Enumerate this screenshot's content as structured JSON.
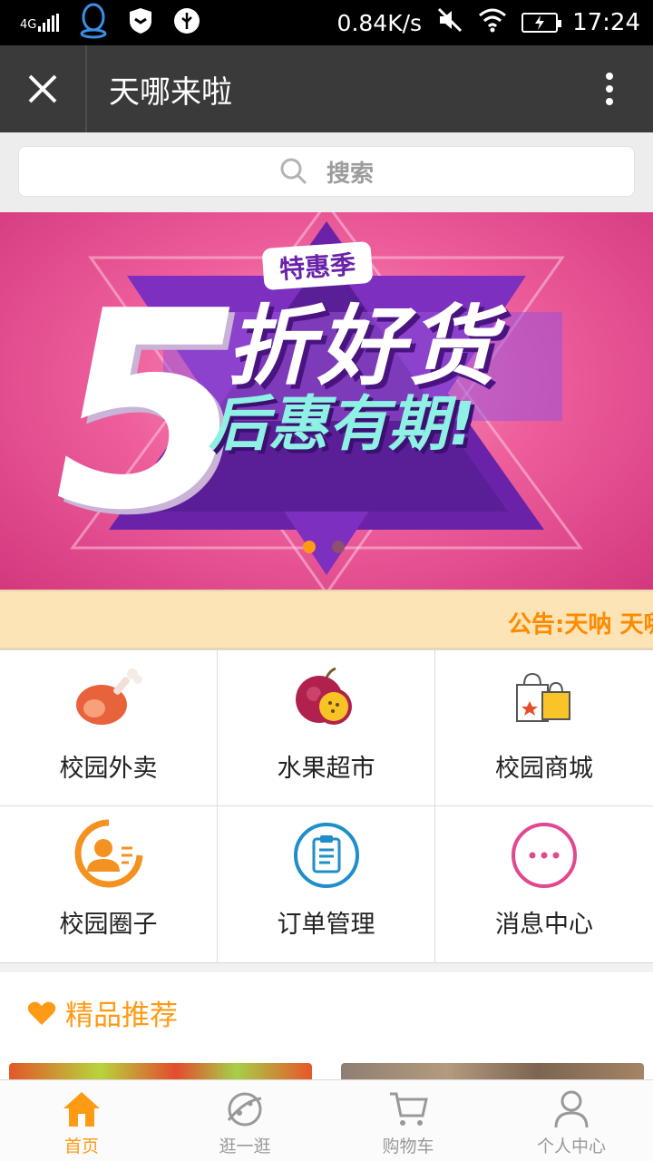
{
  "status_bar": {
    "network": "4G",
    "speed": "0.84K/s",
    "time": "17:24"
  },
  "title_bar": {
    "title": "天哪来啦"
  },
  "search": {
    "placeholder": "搜索"
  },
  "banner": {
    "badge": "特惠季",
    "big_number": "5",
    "headline": "折好货",
    "subline": "后惠有期!",
    "slide_count": 2,
    "active_slide": 1
  },
  "notice": {
    "text": "公告:天呐 天哪"
  },
  "menu": [
    {
      "label": "校园外卖",
      "icon": "ham-icon"
    },
    {
      "label": "水果超市",
      "icon": "passion-fruit-icon"
    },
    {
      "label": "校园商城",
      "icon": "shopping-bags-icon"
    },
    {
      "label": "校园圈子",
      "icon": "user-card-icon"
    },
    {
      "label": "订单管理",
      "icon": "clipboard-icon"
    },
    {
      "label": "消息中心",
      "icon": "chat-dots-icon"
    }
  ],
  "recommend": {
    "title": "精品推荐"
  },
  "tabs": [
    {
      "label": "首页",
      "icon": "home-icon",
      "active": true
    },
    {
      "label": "逛一逛",
      "icon": "planet-icon",
      "active": false
    },
    {
      "label": "购物车",
      "icon": "cart-icon",
      "active": false
    },
    {
      "label": "个人中心",
      "icon": "person-icon",
      "active": false
    }
  ],
  "colors": {
    "accent": "#ff9a15",
    "title_bar": "#3a3a3a",
    "notice_bg": "#fde4b6",
    "inactive": "#999999"
  }
}
